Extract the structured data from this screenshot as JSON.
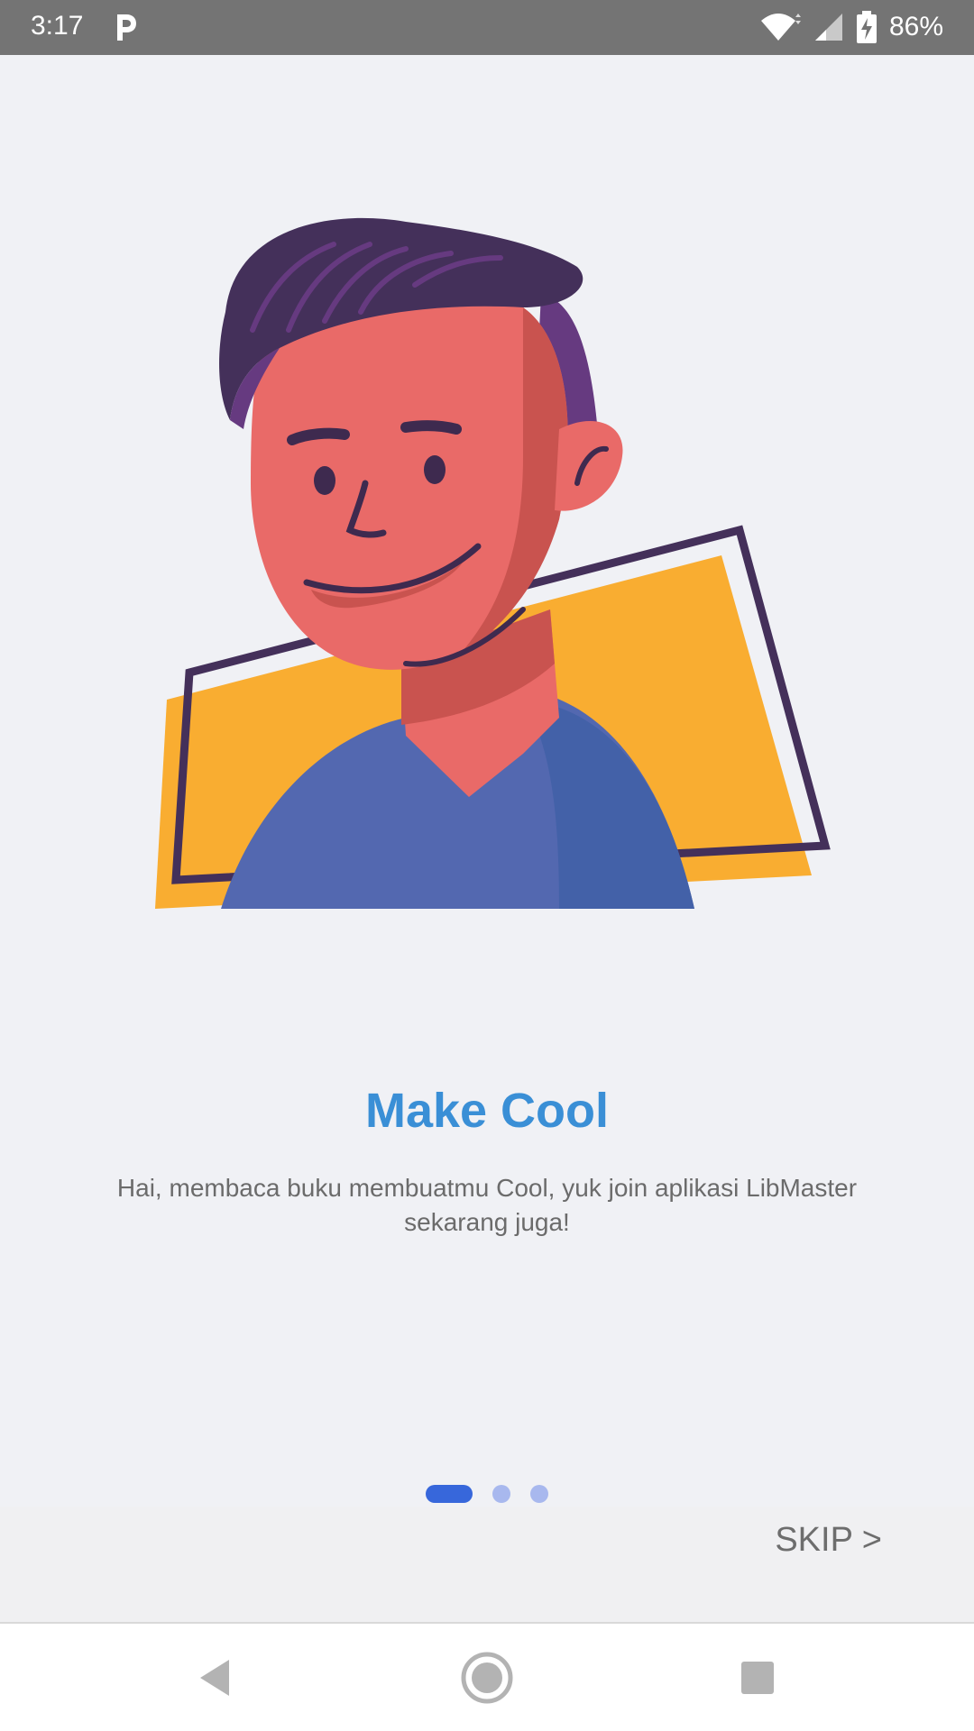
{
  "status_bar": {
    "time": "3:17",
    "app_icon": "parking-p-icon",
    "battery_text": "86%",
    "icons": [
      "wifi-icon",
      "signal-icon",
      "battery-charging-icon"
    ]
  },
  "onboarding": {
    "illustration": "smiling-man-illustration",
    "title": "Make Cool",
    "description": "Hai, membaca buku membuatmu Cool, yuk join aplikasi LibMaster sekarang juga!",
    "pager": {
      "total": 3,
      "current": 1
    }
  },
  "skip": {
    "label": "SKIP >"
  },
  "nav_bar": {
    "icons": [
      "back-icon",
      "home-icon",
      "recent-apps-icon"
    ]
  },
  "colors": {
    "title": "#3a8fd6",
    "pager_active": "#3767db",
    "pager_inactive": "#a8b8ee",
    "background": "#f0f1f5"
  }
}
